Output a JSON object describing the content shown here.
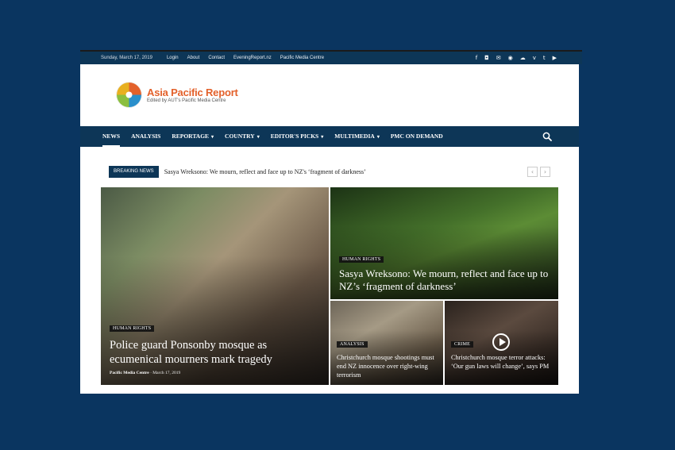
{
  "topbar": {
    "date": "Sunday, March 17, 2019",
    "links": [
      "Login",
      "About",
      "Contact",
      "EveningReport.nz",
      "Pacific Media Centre"
    ],
    "social": [
      "facebook-icon",
      "instagram-icon",
      "mail-icon",
      "rss-icon",
      "soundcloud-icon",
      "vimeo-icon",
      "twitter-icon",
      "youtube-icon"
    ]
  },
  "logo": {
    "title": "Asia Pacific Report",
    "subtitle": "Edited by AUT's Pacific Media Centre",
    "colors": [
      "#e3612b",
      "#2a8fcb",
      "#8bbf3f",
      "#e8b020"
    ]
  },
  "nav": {
    "items": [
      {
        "label": "NEWS",
        "dropdown": false,
        "active": true
      },
      {
        "label": "ANALYSIS",
        "dropdown": false,
        "active": false
      },
      {
        "label": "REPORTAGE",
        "dropdown": true,
        "active": false
      },
      {
        "label": "COUNTRY",
        "dropdown": true,
        "active": false
      },
      {
        "label": "EDITOR'S PICKS",
        "dropdown": true,
        "active": false
      },
      {
        "label": "MULTIMEDIA",
        "dropdown": true,
        "active": false
      },
      {
        "label": "PMC ON DEMAND",
        "dropdown": false,
        "active": false
      }
    ],
    "search_icon": "search-icon"
  },
  "breaking": {
    "badge": "BREAKING NEWS",
    "text": "Sasya Wreksono: We mourn, reflect and face up to NZ's ‘fragment of darkness’"
  },
  "tiles": [
    {
      "category": "HUMAN RIGHTS",
      "headline": "Police guard Ponsonby mosque as ecumenical mourners mark tragedy",
      "author": "Pacific Media Centre",
      "date": "March 17, 2019"
    },
    {
      "category": "HUMAN RIGHTS",
      "headline": "Sasya Wreksono: We mourn, reflect and face up to NZ’s ‘fragment of darkness’"
    },
    {
      "category": "ANALYSIS",
      "headline": "Christchurch mosque shootings must end NZ innocence over right-wing terrorism"
    },
    {
      "category": "CRIME",
      "headline": "Christchurch mosque terror attacks: ‘Our gun laws will change’, says PM"
    }
  ],
  "colors": {
    "navy": "#0d3657",
    "page_bg": "#0a3560",
    "accent": "#e3612b"
  }
}
